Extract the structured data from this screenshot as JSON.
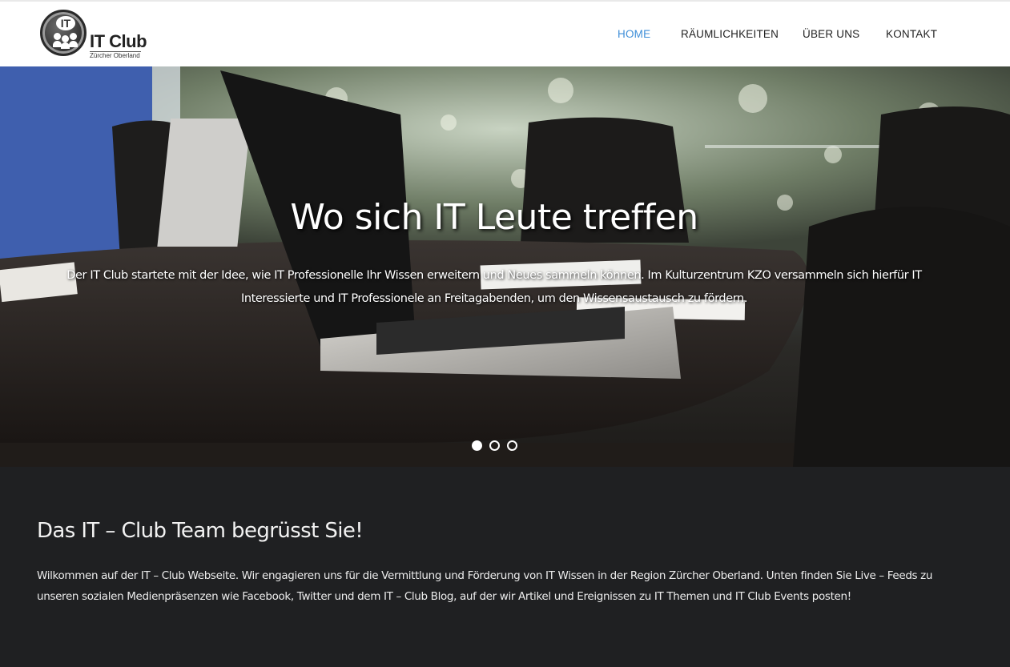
{
  "header": {
    "logo": {
      "mark_text": "IT",
      "title": "IT Club",
      "subtitle": "Zürcher Oberland"
    },
    "nav": [
      {
        "label": "HOME",
        "active": true
      },
      {
        "label": "RÄUMLICHKEITEN",
        "active": false
      },
      {
        "label": "ÜBER UNS",
        "active": false
      },
      {
        "label": "KONTAKT",
        "active": false
      }
    ],
    "accent_color": "#3e8ed8"
  },
  "hero": {
    "title": "Wo sich IT Leute treffen",
    "text": "Der IT Club startete mit der Idee, wie IT Professionelle Ihr Wissen erweitern und Neues sammeln können. Im Kulturzentrum KZO versammeln sich hierfür IT Interessierte und IT Professionele an Freitagabenden, um den Wissensaustausch zu fördern.",
    "slides": {
      "count": 3,
      "active_index": 0
    }
  },
  "welcome": {
    "heading": "Das IT – Club Team begrüsst Sie!",
    "paragraph": "Wilkommen auf der IT  – Club Webseite. Wir engagieren uns für die Vermittlung und Förderung von IT Wissen in der Region Zürcher Oberland. Unten finden Sie Live – Feeds zu unseren sozialen Medienpräsenzen wie Facebook, Twitter und dem IT – Club Blog, auf der wir Artikel und Ereignissen zu IT Themen und IT Club Events posten!",
    "background_color": "#1f2022"
  }
}
